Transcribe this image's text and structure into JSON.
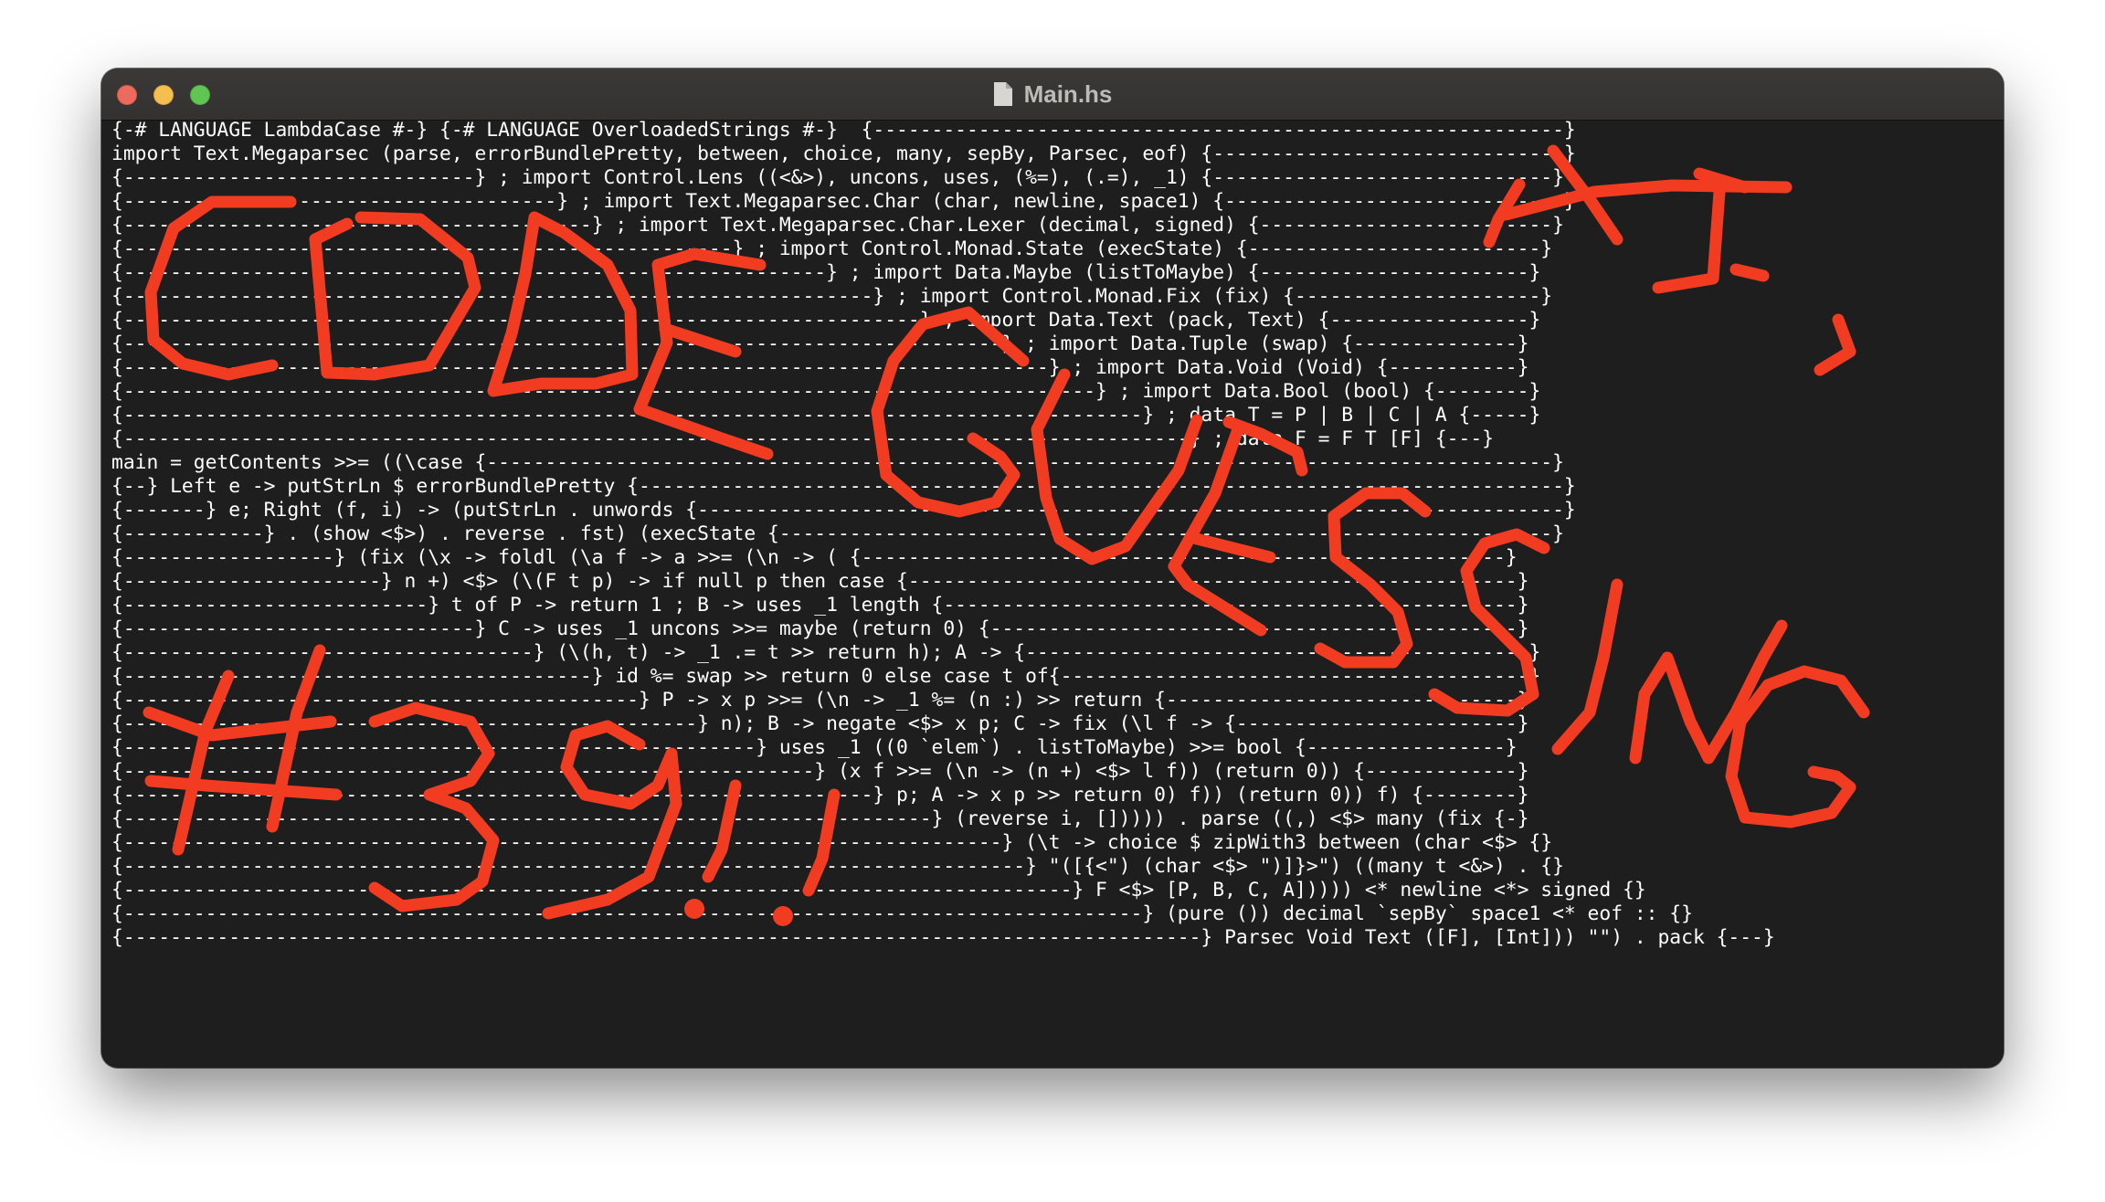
{
  "window": {
    "title": "Main.hs",
    "title_icon": "document-icon",
    "background_color": "#1e1e1e",
    "text_color": "#ffffff",
    "titlebar_color": "#3a3836"
  },
  "traffic_lights": {
    "close_color": "#ed6a5e",
    "minimize_color": "#f5bf4f",
    "maximize_color": "#61c554"
  },
  "code_lines": [
    "{-# LANGUAGE LambdaCase #-} {-# LANGUAGE OverloadedStrings #-}  {-----------------------------------------------------------}",
    "import Text.Megaparsec (parse, errorBundlePretty, between, choice, many, sepBy, Parsec, eof) {------------------------------}",
    "{------------------------------} ; import Control.Lens ((<&>), uncons, uses, (%=), (.=), _1) {-----------------------------}",
    "{-------------------------------------} ; import Text.Megaparsec.Char (char, newline, space1) {-----------------------------}",
    "{----------------------------------------} ; import Text.Megaparsec.Char.Lexer (decimal, signed) {-------------------------}",
    "{----------------------------------------------------} ; import Control.Monad.State (execState) {-------------------------}",
    "{------------------------------------------------------------} ; import Data.Maybe (listToMaybe) {-----------------------}",
    "{----------------------------------------------------------------} ; import Control.Monad.Fix (fix) {---------------------}",
    "{--------------------------------------------------------------------} ; import Data.Text (pack, Text) {-----------------}",
    "{---------------------------------------------------------------------------} ; import Data.Tuple (swap) {--------------}",
    "{-------------------------------------------------------------------------------} ; import Data.Void (Void) {-----------}",
    "{-----------------------------------------------------------------------------------} ; import Data.Bool (bool) {--------}",
    "{---------------------------------------------------------------------------------------} ; data T = P | B | C | A {-----}",
    "{-------------------------------------------------------------------------------------------} ; data F = F T [F] {---}",
    "main = getContents >>= ((\\case {-------------------------------------------------------------------------------------------}",
    "{--} Left e -> putStrLn $ errorBundlePretty {-------------------------------------------------------------------------------}",
    "{-------} e; Right (f, i) -> (putStrLn . unwords {--------------------------------------------------------------------------}",
    "{------------} . (show <$>) . reverse . fst) (execState {------------------------------------------------------------------}",
    "{------------------} (fix (\\x -> foldl (\\a f -> a >>= (\\n -> ( {-------------------------------------------------------}",
    "{----------------------} n +) <$> (\\(F t p) -> if null p then case {----------------------------------------------------}",
    "{--------------------------} t of P -> return 1 ; B -> uses _1 length {-------------------------------------------------}",
    "{------------------------------} C -> uses _1 uncons >>= maybe (return 0) {---------------------------------------------}",
    "{-----------------------------------} (\\(h, t) -> _1 .= t >> return h); A -> {-------------------------------------------}",
    "{----------------------------------------} id %= swap >> return 0 else case t of{----------------------------------------}",
    "{--------------------------------------------} P -> x p >>= (\\n -> _1 %= (n :) >> return {------------------------------}",
    "{-------------------------------------------------} n); B -> negate <$> x p; C -> fix (\\l f -> {------------------------}",
    "{------------------------------------------------------} uses _1 ((0 `elem`) . listToMaybe) >>= bool {-----------------}",
    "{-----------------------------------------------------------} (x f >>= (\\n -> (n +) <$> l f)) (return 0)) {-------------}",
    "{----------------------------------------------------------------} p; A -> x p >> return 0) f)) (return 0)) f) {--------}",
    "{---------------------------------------------------------------------} (reverse i, [])))) . parse ((,) <$> many (fix {-}",
    "{---------------------------------------------------------------------------} (\\t -> choice $ zipWith3 between (char <$> {}",
    "{-----------------------------------------------------------------------------} \"([{<\") (char <$> \")]}>\") ((many t <&>) . {}",
    "{---------------------------------------------------------------------------------} F <$> [P, B, C, A])))) <* newline <*> signed {}",
    "{---------------------------------------------------------------------------------------} (pure ()) decimal `sepBy` space1 <* eof :: {}",
    "{--------------------------------------------------------------------------------------------} Parsec Void Text ([F], [Int])) \"\") . pack {---}"
  ],
  "annotation": {
    "color": "#f23c22",
    "hi": "HI,",
    "code": "CODE",
    "guessing": "GUESSING",
    "number": "#39!!"
  }
}
